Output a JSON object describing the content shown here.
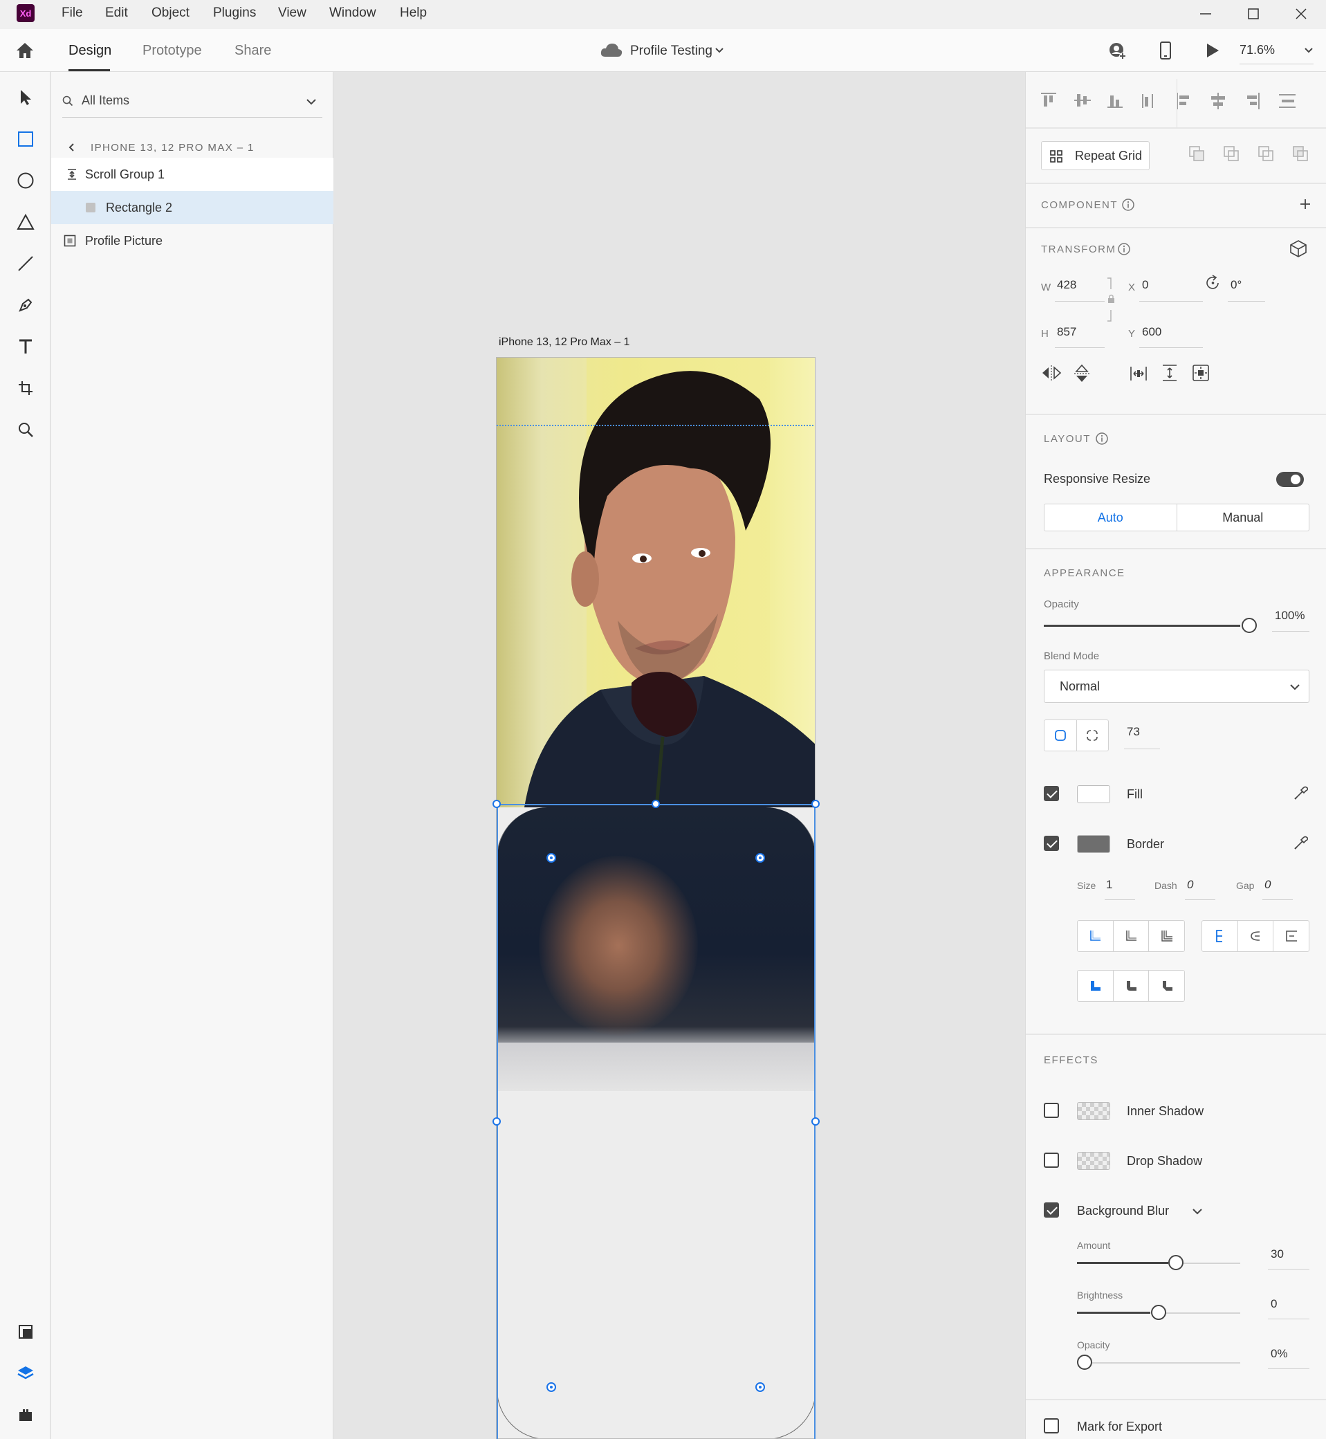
{
  "menubar": {
    "app_badge": "Xd",
    "items": [
      "File",
      "Edit",
      "Object",
      "Plugins",
      "View",
      "Window",
      "Help"
    ],
    "window_controls": [
      "minimize-icon",
      "maximize-icon",
      "close-icon"
    ]
  },
  "topbar": {
    "tabs": [
      "Design",
      "Prototype",
      "Share"
    ],
    "active_tab": "Design",
    "document_title": "Profile Testing",
    "zoom": "71.6%"
  },
  "layers": {
    "search_placeholder": "All Items",
    "breadcrumb": "IPHONE 13, 12 PRO MAX – 1",
    "items": [
      {
        "label": "Scroll Group 1",
        "icon": "scroll-group-icon"
      },
      {
        "label": "Rectangle 2",
        "icon": "rectangle-icon",
        "selected": true
      },
      {
        "label": "Profile Picture",
        "icon": "image-group-icon"
      }
    ]
  },
  "canvas": {
    "artboard_title": "iPhone 13, 12 Pro Max – 1"
  },
  "props": {
    "repeat_grid": "Repeat Grid",
    "component_title": "COMPONENT",
    "transform_title": "TRANSFORM",
    "transform": {
      "w_label": "W",
      "w": "428",
      "x_label": "X",
      "x": "0",
      "h_label": "H",
      "h": "857",
      "y_label": "Y",
      "y": "600",
      "rotation": "0°"
    },
    "layout_title": "LAYOUT",
    "responsive_resize": "Responsive Resize",
    "responsive_on": true,
    "auto": "Auto",
    "manual": "Manual",
    "appearance_title": "APPEARANCE",
    "opacity_label": "Opacity",
    "opacity": "100%",
    "blend_label": "Blend Mode",
    "blend": "Normal",
    "corner_radius": "73",
    "fill_label": "Fill",
    "fill_enabled": true,
    "fill_color": "#ffffff",
    "border_label": "Border",
    "border_enabled": true,
    "border_color": "#6e6e6e",
    "size_label": "Size",
    "size": "1",
    "dash_label": "Dash",
    "dash": "0",
    "gap_label": "Gap",
    "gap": "0",
    "effects_title": "EFFECTS",
    "inner_shadow": "Inner Shadow",
    "drop_shadow": "Drop Shadow",
    "background_blur": "Background Blur",
    "amount_label": "Amount",
    "amount": "30",
    "brightness_label": "Brightness",
    "brightness": "0",
    "blur_opacity_label": "Opacity",
    "blur_opacity": "0%",
    "mark_export": "Mark for Export",
    "accent_color": "#1473e6"
  }
}
